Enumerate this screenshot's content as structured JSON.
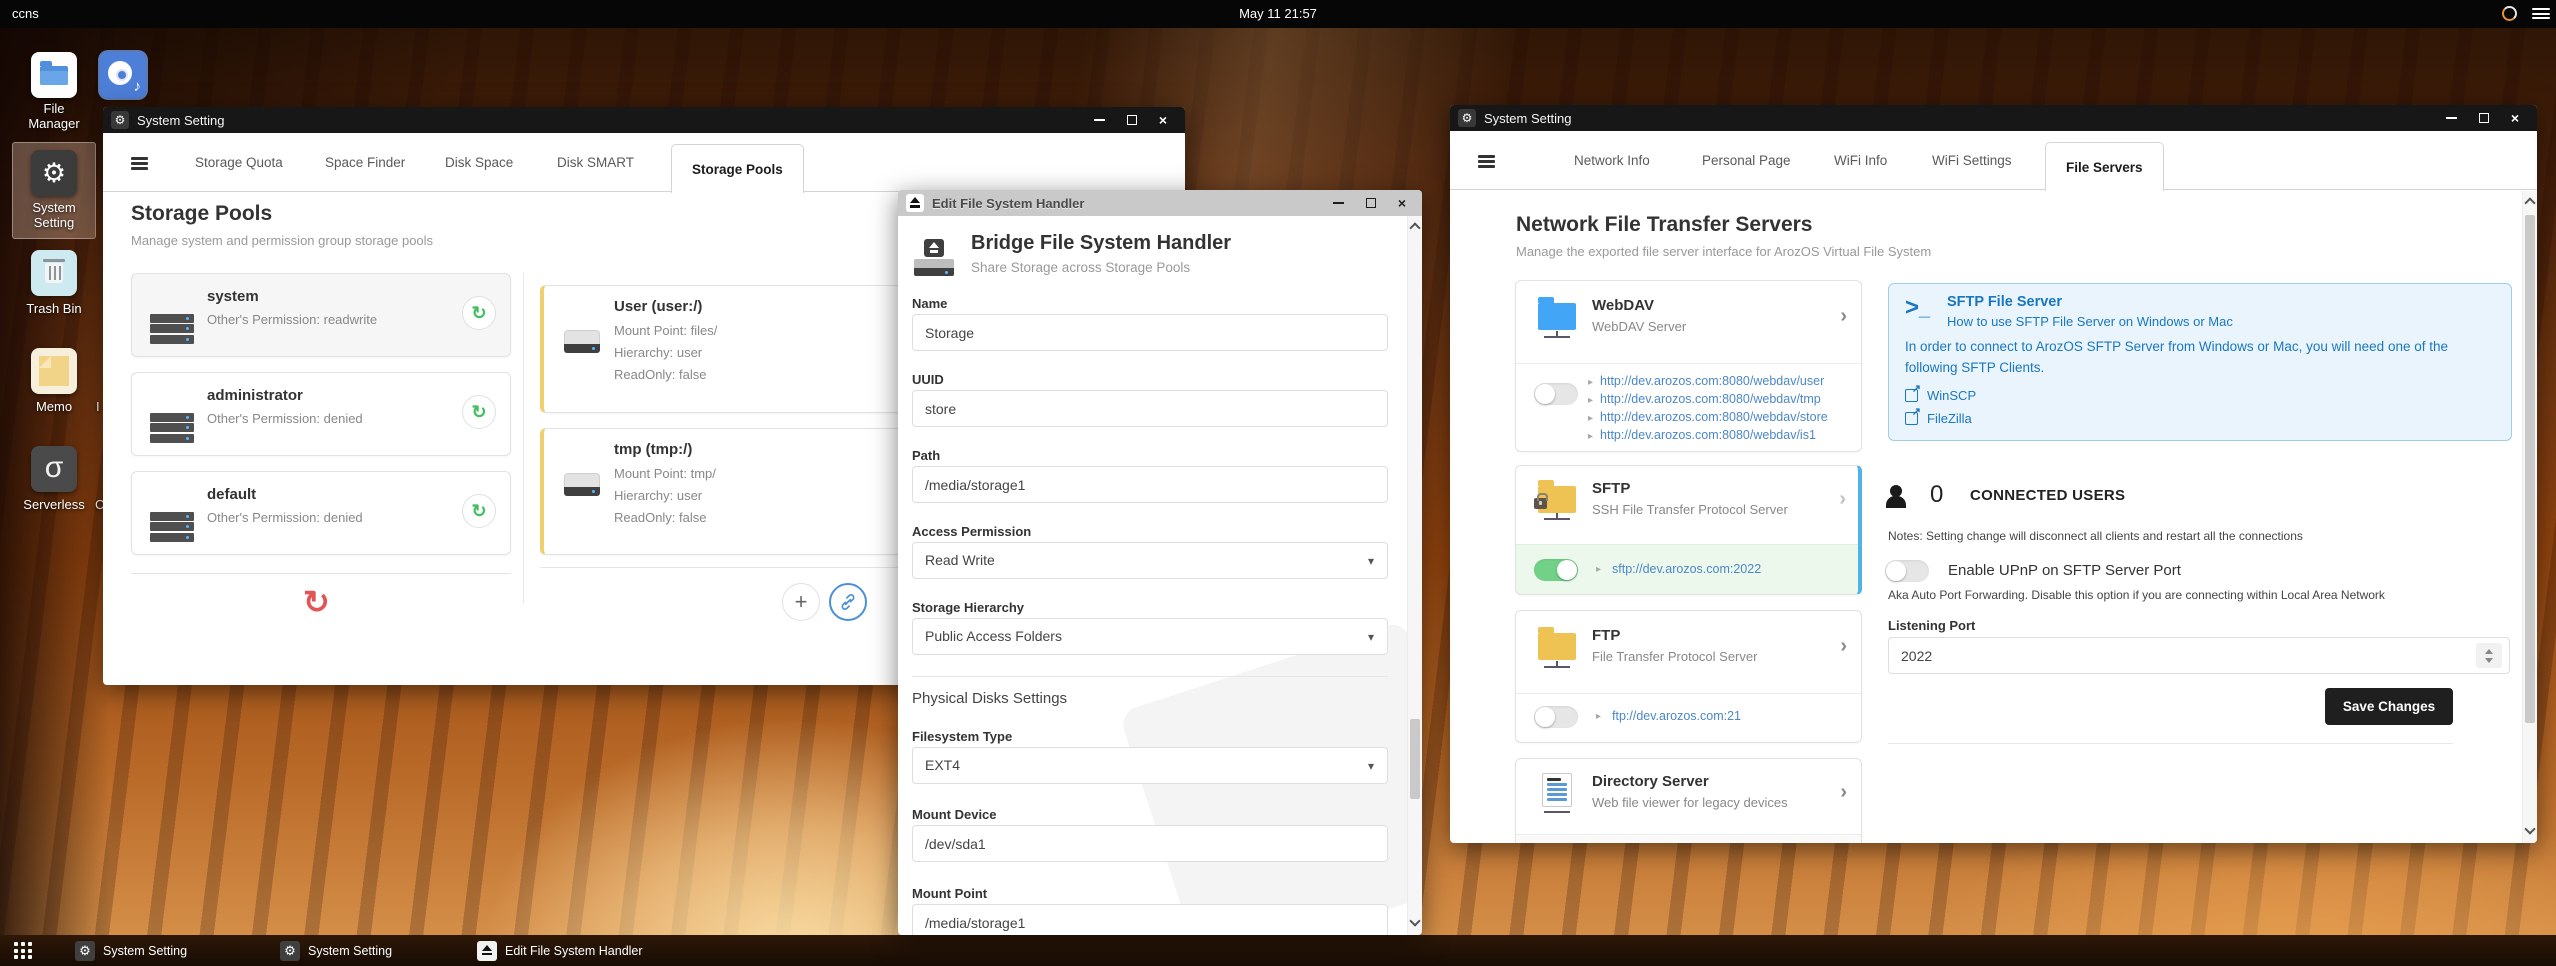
{
  "topbar": {
    "host": "ccns",
    "clock": "May 11 21:57"
  },
  "desktop": {
    "icons": [
      {
        "label_line1": "File",
        "label_line2": "Manager"
      },
      {
        "label_line1": "System",
        "label_line2": "Setting"
      },
      {
        "label_line1": "Trash Bin",
        "label_line2": ""
      },
      {
        "label_line1": "Memo",
        "label_line2": ""
      },
      {
        "label_line1": "Serverless",
        "label_line2": ""
      }
    ],
    "partial_labels": [
      "I",
      "C"
    ]
  },
  "left_window": {
    "title": "System Setting",
    "tabs": [
      {
        "label": "Storage Quota"
      },
      {
        "label": "Space Finder"
      },
      {
        "label": "Disk Space"
      },
      {
        "label": "Disk SMART"
      },
      {
        "label": "Storage Pools"
      }
    ],
    "heading": "Storage Pools",
    "subheading": "Manage system and permission group storage pools",
    "pools": [
      {
        "name": "system",
        "permission": "Other's Permission: readwrite"
      },
      {
        "name": "administrator",
        "permission": "Other's Permission: denied"
      },
      {
        "name": "default",
        "permission": "Other's Permission: denied"
      }
    ],
    "handlers": [
      {
        "title": "User (user:/)",
        "lines": [
          "Mount Point: files/",
          "Hierarchy: user",
          "ReadOnly: false"
        ]
      },
      {
        "title": "tmp (tmp:/)",
        "lines": [
          "Mount Point: tmp/",
          "Hierarchy: user",
          "ReadOnly: false"
        ]
      }
    ]
  },
  "edit_window": {
    "title": "Edit File System Handler",
    "heading": "Bridge File System Handler",
    "subheading": "Share Storage across Storage Pools",
    "fields": {
      "name_label": "Name",
      "name_value": "Storage",
      "uuid_label": "UUID",
      "uuid_value": "store",
      "path_label": "Path",
      "path_value": "/media/storage1",
      "access_label": "Access Permission",
      "access_value": "Read Write",
      "hierarchy_label": "Storage Hierarchy",
      "hierarchy_value": "Public Access Folders",
      "section_title": "Physical Disks Settings",
      "fstype_label": "Filesystem Type",
      "fstype_value": "EXT4",
      "mount_device_label": "Mount Device",
      "mount_device_value": "/dev/sda1",
      "mount_point_label": "Mount Point",
      "mount_point_value": "/media/storage1"
    }
  },
  "right_window": {
    "title": "System Setting",
    "tabs": [
      {
        "label": "Network Info"
      },
      {
        "label": "Personal Page"
      },
      {
        "label": "WiFi Info"
      },
      {
        "label": "WiFi Settings"
      },
      {
        "label": "File Servers"
      }
    ],
    "heading": "Network File Transfer Servers",
    "subheading": "Manage the exported file server interface for ArozOS Virtual File System",
    "webdav": {
      "name": "WebDAV",
      "desc": "WebDAV Server",
      "links": [
        "http://dev.arozos.com:8080/webdav/user",
        "http://dev.arozos.com:8080/webdav/tmp",
        "http://dev.arozos.com:8080/webdav/store",
        "http://dev.arozos.com:8080/webdav/is1"
      ]
    },
    "sftp": {
      "name": "SFTP",
      "desc": "SSH File Transfer Protocol Server",
      "link": "sftp://dev.arozos.com:2022"
    },
    "ftp": {
      "name": "FTP",
      "desc": "File Transfer Protocol Server",
      "link": "ftp://dev.arozos.com:21"
    },
    "dirserver": {
      "name": "Directory Server",
      "desc": "Web file viewer for legacy devices"
    },
    "sftp_help": {
      "title": "SFTP File Server",
      "subtitle": "How to use SFTP File Server on Windows or Mac",
      "body": "In order to connect to ArozOS SFTP Server from Windows or Mac, you will need one of the following SFTP Clients.",
      "clients": [
        "WinSCP",
        "FileZilla"
      ]
    },
    "connected": {
      "count": "0",
      "label": "CONNECTED USERS",
      "notes": "Notes: Setting change will disconnect all clients and restart all the connections"
    },
    "upnp": {
      "label": "Enable UPnP on SFTP Server Port",
      "desc": "Aka Auto Port Forwarding. Disable this option if you are connecting within Local Area Network"
    },
    "port": {
      "label": "Listening Port",
      "value": "2022"
    },
    "save_label": "Save Changes"
  },
  "taskbar": {
    "items": [
      "System Setting",
      "System Setting",
      "Edit File System Handler"
    ]
  },
  "colors": {
    "link_blue": "#4c87c7",
    "toggle_on_green": "#71d287",
    "sftp_selected_border": "#4fb3e8",
    "info_blue": "#1b77c0",
    "save_button_bg": "#1f1f1f",
    "webdav_folder": "#42a5f5",
    "ftp_folder": "#eec253"
  }
}
